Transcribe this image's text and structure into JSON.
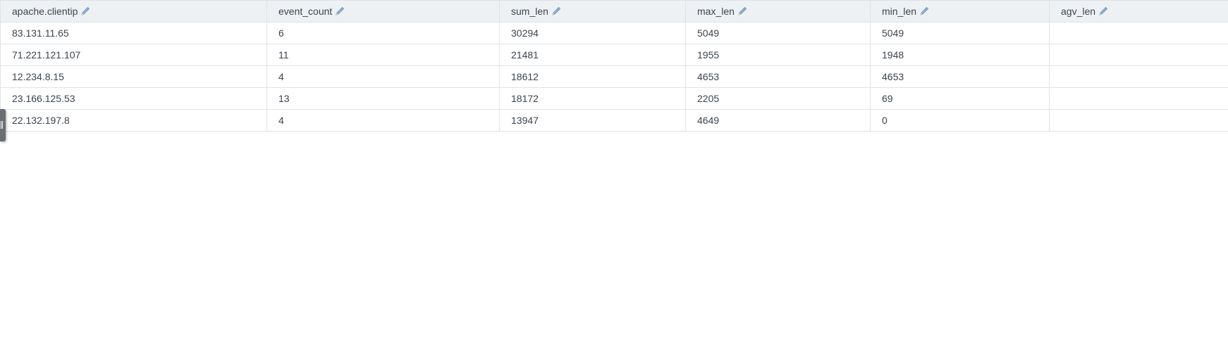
{
  "table": {
    "columns": [
      {
        "label": "apache.clientip"
      },
      {
        "label": "event_count"
      },
      {
        "label": "sum_len"
      },
      {
        "label": "max_len"
      },
      {
        "label": "min_len"
      },
      {
        "label": "agv_len"
      }
    ],
    "rows": [
      [
        "83.131.11.65",
        "6",
        "30294",
        "5049",
        "5049",
        ""
      ],
      [
        "71.221.121.107",
        "11",
        "21481",
        "1955",
        "1948",
        ""
      ],
      [
        "12.234.8.15",
        "4",
        "18612",
        "4653",
        "4653",
        ""
      ],
      [
        "23.166.125.53",
        "13",
        "18172",
        "2205",
        "69",
        ""
      ],
      [
        "22.132.197.8",
        "4",
        "13947",
        "4649",
        "0",
        ""
      ]
    ]
  },
  "icons": {
    "column_edit": "pencil-icon",
    "side_handle": "drag-handle-icon"
  },
  "colors": {
    "header_background": "#eef1f4",
    "grid_line": "#dfe2e5",
    "text": "#3c444d",
    "pencil": "#8fb3d6"
  }
}
